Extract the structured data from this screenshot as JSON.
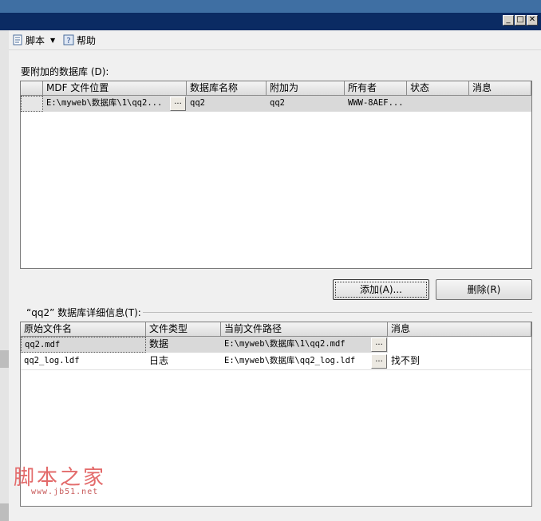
{
  "toolbar": {
    "script_label": "脚本",
    "help_label": "帮助"
  },
  "attach": {
    "label": "要附加的数据库 (D):",
    "columns": [
      "MDF 文件位置",
      "数据库名称",
      "附加为",
      "所有者",
      "状态",
      "消息"
    ],
    "rows": [
      {
        "mdf": "E:\\myweb\\数据库\\1\\qq2...",
        "dbname": "qq2",
        "attach_as": "qq2",
        "owner": "WWW-8AEF...",
        "status": "",
        "message": ""
      }
    ],
    "ellipsis": "...",
    "add_button": "添加(A)...",
    "remove_button": "删除(R)"
  },
  "details": {
    "label": "“qq2” 数据库详细信息(T):",
    "columns": [
      "原始文件名",
      "文件类型",
      "当前文件路径",
      "消息"
    ],
    "rows": [
      {
        "name": "qq2.mdf",
        "type": "数据",
        "path": "E:\\myweb\\数据库\\1\\qq2.mdf",
        "message": ""
      },
      {
        "name": "qq2_log.ldf",
        "type": "日志",
        "path": "E:\\myweb\\数据库\\qq2_log.ldf",
        "message": "找不到"
      }
    ],
    "ellipsis": "..."
  },
  "window_buttons": {
    "minimize": "_",
    "maximize": "□",
    "close": "✕"
  },
  "watermark": {
    "title": "脚本之家",
    "url": "www.jb51.net"
  }
}
